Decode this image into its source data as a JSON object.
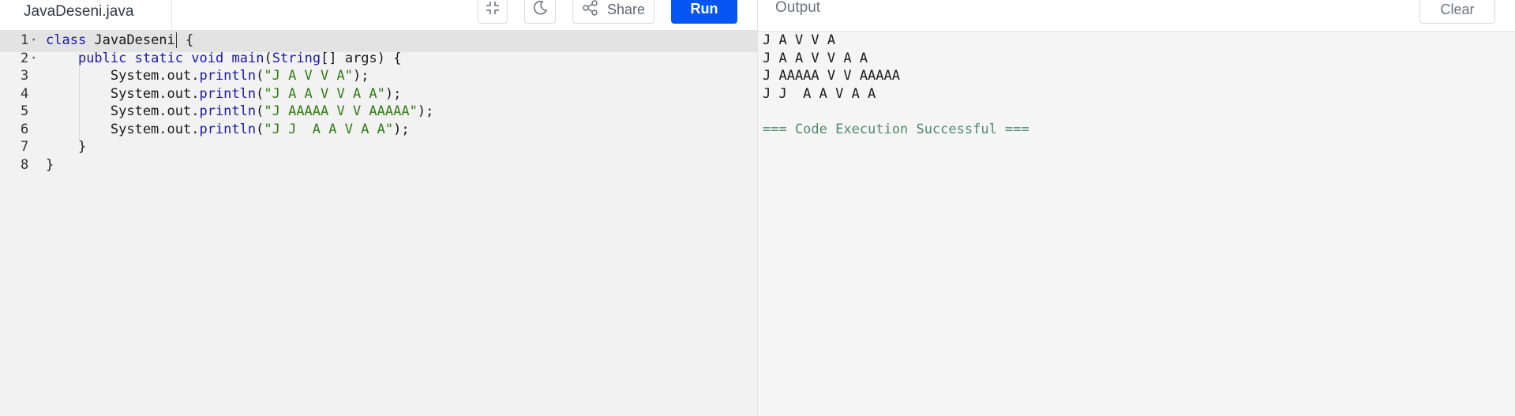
{
  "file_tab": {
    "name": "JavaDeseni.java"
  },
  "toolbar": {
    "exit_fullscreen_icon": "compress-icon",
    "theme_icon": "moon-icon",
    "share_icon": "share-icon",
    "share_label": "Share",
    "run_label": "Run"
  },
  "output_panel": {
    "title": "Output",
    "clear_label": "Clear",
    "lines": [
      "J A V V A",
      "J A A V V A A",
      "J AAAAA V V AAAAA",
      "J J  A A V A A",
      "",
      "=== Code Execution Successful ==="
    ]
  },
  "editor": {
    "line_numbers": [
      "1",
      "2",
      "3",
      "4",
      "5",
      "6",
      "7",
      "8"
    ],
    "lines": [
      {
        "tokens": [
          {
            "text": "class",
            "kind": "kw"
          },
          {
            "text": " JavaDeseni",
            "kind": "def"
          },
          {
            "text": " {",
            "kind": "def"
          }
        ]
      },
      {
        "tokens": [
          {
            "text": "    ",
            "kind": "def"
          },
          {
            "text": "public",
            "kind": "kw"
          },
          {
            "text": " ",
            "kind": "def"
          },
          {
            "text": "static",
            "kind": "kw"
          },
          {
            "text": " ",
            "kind": "def"
          },
          {
            "text": "void",
            "kind": "kw"
          },
          {
            "text": " ",
            "kind": "def"
          },
          {
            "text": "main",
            "kind": "meth"
          },
          {
            "text": "(",
            "kind": "def"
          },
          {
            "text": "String",
            "kind": "kw"
          },
          {
            "text": "[] args) {",
            "kind": "def"
          }
        ]
      },
      {
        "tokens": [
          {
            "text": "        System.out.",
            "kind": "def"
          },
          {
            "text": "println",
            "kind": "meth"
          },
          {
            "text": "(",
            "kind": "def"
          },
          {
            "text": "\"J A V V A\"",
            "kind": "str"
          },
          {
            "text": ");",
            "kind": "def"
          }
        ]
      },
      {
        "tokens": [
          {
            "text": "        System.out.",
            "kind": "def"
          },
          {
            "text": "println",
            "kind": "meth"
          },
          {
            "text": "(",
            "kind": "def"
          },
          {
            "text": "\"J A A V V A A\"",
            "kind": "str"
          },
          {
            "text": ");",
            "kind": "def"
          }
        ]
      },
      {
        "tokens": [
          {
            "text": "        System.out.",
            "kind": "def"
          },
          {
            "text": "println",
            "kind": "meth"
          },
          {
            "text": "(",
            "kind": "def"
          },
          {
            "text": "\"J AAAAA V V AAAAA\"",
            "kind": "str"
          },
          {
            "text": ");",
            "kind": "def"
          }
        ]
      },
      {
        "tokens": [
          {
            "text": "        System.out.",
            "kind": "def"
          },
          {
            "text": "println",
            "kind": "meth"
          },
          {
            "text": "(",
            "kind": "def"
          },
          {
            "text": "\"J J  A A V A A\"",
            "kind": "str"
          },
          {
            "text": ");",
            "kind": "def"
          }
        ]
      },
      {
        "tokens": [
          {
            "text": "    }",
            "kind": "def"
          }
        ]
      },
      {
        "tokens": [
          {
            "text": "}",
            "kind": "def"
          }
        ]
      }
    ]
  },
  "colors": {
    "run_button": "#0556f3",
    "keyword": "#1a1aa6",
    "string": "#2f7d12",
    "success": "#4e8a6b"
  }
}
